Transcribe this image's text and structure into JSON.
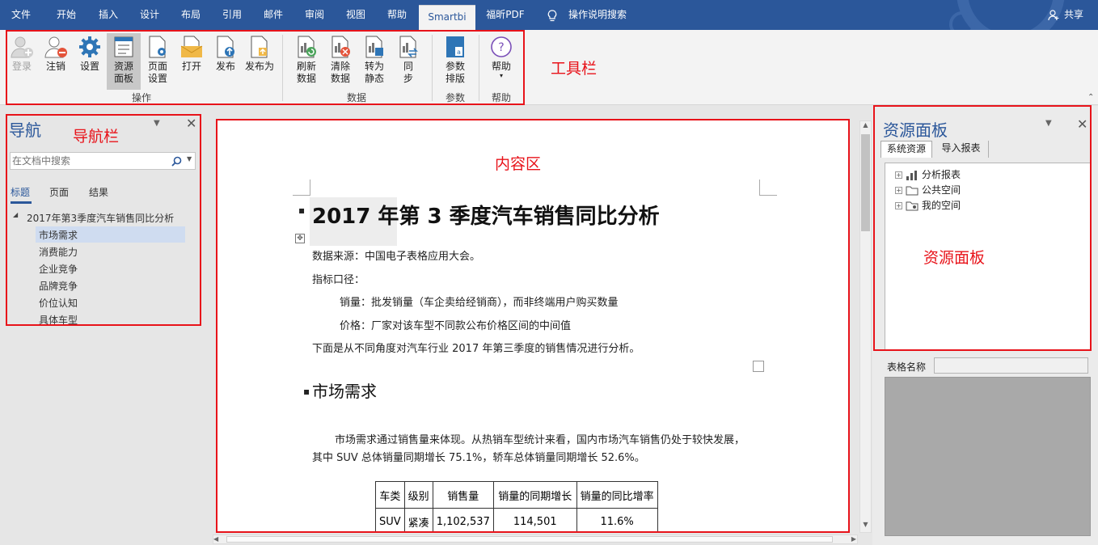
{
  "menu": {
    "items": [
      "文件",
      "开始",
      "插入",
      "设计",
      "布局",
      "引用",
      "邮件",
      "审阅",
      "视图",
      "帮助",
      "Smartbi",
      "福昕PDF"
    ],
    "active": "Smartbi",
    "search_label": "操作说明搜索",
    "share_label": "共享"
  },
  "ribbon": {
    "buttons": {
      "login": "登录",
      "logout": "注销",
      "settings": "设置",
      "resource_panel_1": "资源",
      "resource_panel_2": "面板",
      "page_setup_1": "页面",
      "page_setup_2": "设置",
      "open": "打开",
      "publish": "发布",
      "publish_as": "发布为",
      "refresh_1": "刷新",
      "refresh_2": "数据",
      "clear_1": "清除",
      "clear_2": "数据",
      "static_1": "转为",
      "static_2": "静态",
      "sync_1": "同",
      "sync_2": "步",
      "param_1": "参数",
      "param_2": "排版",
      "help": "帮助"
    },
    "groups": {
      "operations": "操作",
      "data": "数据",
      "params": "参数",
      "help": "帮助"
    }
  },
  "annotations": {
    "toolbar": "工具栏",
    "navbar": "导航栏",
    "content": "内容区",
    "resource": "资源面板"
  },
  "nav": {
    "title": "导航",
    "search_placeholder": "在文档中搜索",
    "tabs": [
      "标题",
      "页面",
      "结果"
    ],
    "active_tab": "标题",
    "root": "2017年第3季度汽车销售同比分析",
    "items": [
      "市场需求",
      "消费能力",
      "企业竞争",
      "品牌竞争",
      "价位认知",
      "具体车型"
    ],
    "selected": "市场需求"
  },
  "document": {
    "title": "2017 年第 3 季度汽车销售同比分析",
    "line1": "数据来源：中国电子表格应用大会。",
    "line2": "指标口径：",
    "line3": "销量：批发销量（车企卖给经销商），而非终端用户购买数量",
    "line4": "价格：厂家对该车型不同款公布价格区间的中间值",
    "line5": "下面是从不同角度对汽车行业 2017 年第三季度的销售情况进行分析。",
    "heading2": "市场需求",
    "para1": "市场需求通过销售量来体现。从热销车型统计来看，国内市场汽车销售仍处于较快发展，",
    "para2": "其中 SUV 总体销量同期增长 75.1%，轿车总体销量同期增长 52.6%。",
    "table": {
      "headers": [
        "车类",
        "级别",
        "销售量",
        "销量的同期增长",
        "销量的同比增率"
      ],
      "rows": [
        [
          "SUV",
          "紧凑",
          "1,102,537",
          "114,501",
          "11.6%"
        ]
      ]
    }
  },
  "resource": {
    "title": "资源面板",
    "tabs": [
      "系统资源",
      "导入报表"
    ],
    "active_tab": "系统资源",
    "tree": [
      "分析报表",
      "公共空间",
      "我的空间"
    ],
    "table_name_label": "表格名称",
    "table_name_value": ""
  }
}
